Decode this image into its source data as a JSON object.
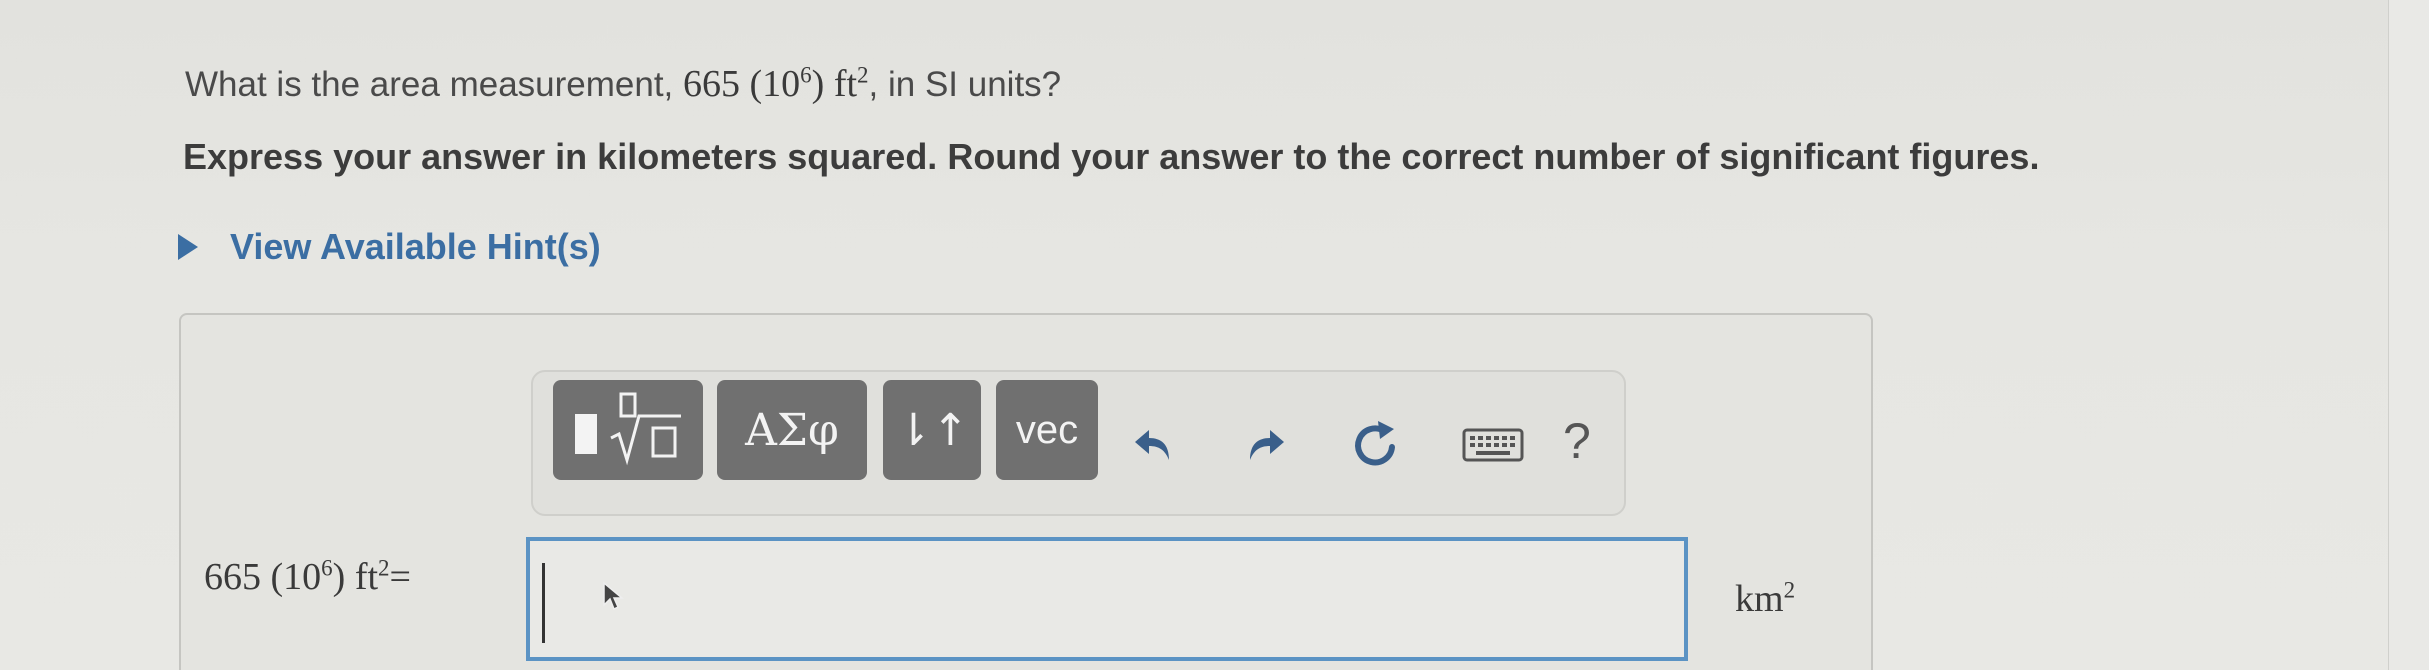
{
  "question": {
    "prefix": "What is the area measurement, ",
    "coefficient": "665",
    "power_base": "(10",
    "power_exp": "6",
    "power_close": ")",
    "unit_base": "ft",
    "unit_exp": "2",
    "suffix": ", in SI units?"
  },
  "instruction": "Express your answer in kilometers squared. Round your answer to the correct number of significant figures.",
  "hint": {
    "label": "View Available Hint(s)"
  },
  "toolbar": {
    "greek_label": "ΑΣφ",
    "arrows_label": "⇂↑",
    "vec_label": "vec",
    "help_label": "?"
  },
  "equation": {
    "coefficient": "665",
    "power_base": "(10",
    "power_exp": "6",
    "power_close": ")",
    "unit_base": "ft",
    "unit_exp": "2",
    "equals": "="
  },
  "answer": {
    "value": "",
    "unit_base": "km",
    "unit_exp": "2"
  },
  "colors": {
    "link": "#3b6ea3",
    "button_bg": "#707070",
    "input_border": "#5b93c4"
  }
}
